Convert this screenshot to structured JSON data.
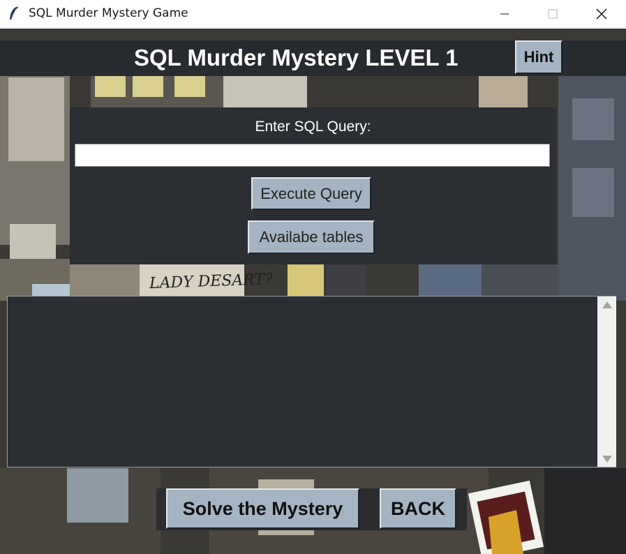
{
  "window": {
    "title": "SQL Murder Mystery Game",
    "icon": "feather-icon"
  },
  "header": {
    "title": "SQL Murder Mystery LEVEL 1",
    "hint_label": "Hint"
  },
  "query_panel": {
    "label": "Enter SQL Query:",
    "input_value": "",
    "execute_label": "Execute Query",
    "tables_label": "Availabe tables"
  },
  "results": {
    "text": ""
  },
  "footer": {
    "solve_label": "Solve the Mystery",
    "back_label": "BACK"
  },
  "background": {
    "note_text": "LADY DESART?"
  },
  "colors": {
    "button_bg": "#a4b4c2",
    "panel_bg": "#2b2e33",
    "header_bg": "#272a2e"
  }
}
